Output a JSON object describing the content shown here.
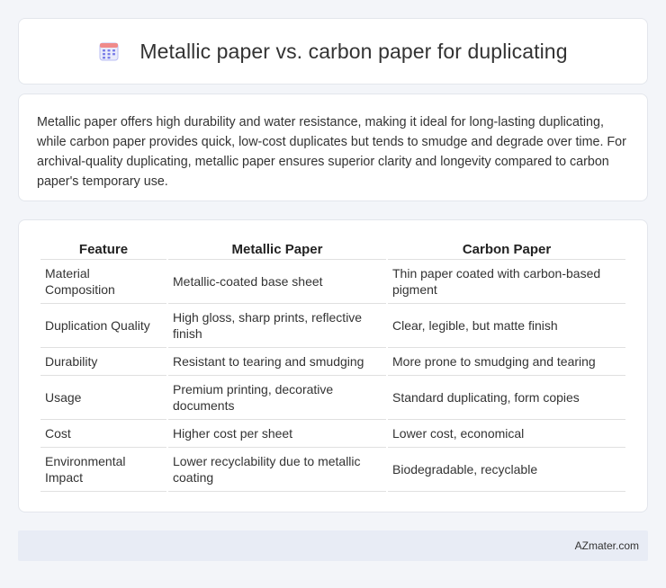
{
  "header": {
    "title": "Metallic paper vs. carbon paper for duplicating",
    "icon": "calendar-icon"
  },
  "summary": {
    "text": "Metallic paper offers high durability and water resistance, making it ideal for long-lasting duplicating, while carbon paper provides quick, low-cost duplicates but tends to smudge and degrade over time. For archival-quality duplicating, metallic paper ensures superior clarity and longevity compared to carbon paper's temporary use."
  },
  "table": {
    "headers": [
      "Feature",
      "Metallic Paper",
      "Carbon Paper"
    ],
    "rows": [
      [
        "Material Composition",
        "Metallic-coated base sheet",
        "Thin paper coated with carbon-based pigment"
      ],
      [
        "Duplication Quality",
        "High gloss, sharp prints, reflective finish",
        "Clear, legible, but matte finish"
      ],
      [
        "Durability",
        "Resistant to tearing and smudging",
        "More prone to smudging and tearing"
      ],
      [
        "Usage",
        "Premium printing, decorative documents",
        "Standard duplicating, form copies"
      ],
      [
        "Cost",
        "Higher cost per sheet",
        "Lower cost, economical"
      ],
      [
        "Environmental Impact",
        "Lower recyclability due to metallic coating",
        "Biodegradable, recyclable"
      ]
    ]
  },
  "footer": {
    "brand": "AZmater.com"
  },
  "colors": {
    "background": "#f3f5f9",
    "card": "#ffffff",
    "footer": "#e8ecf5",
    "icon_accent": "#7b7fe8"
  }
}
